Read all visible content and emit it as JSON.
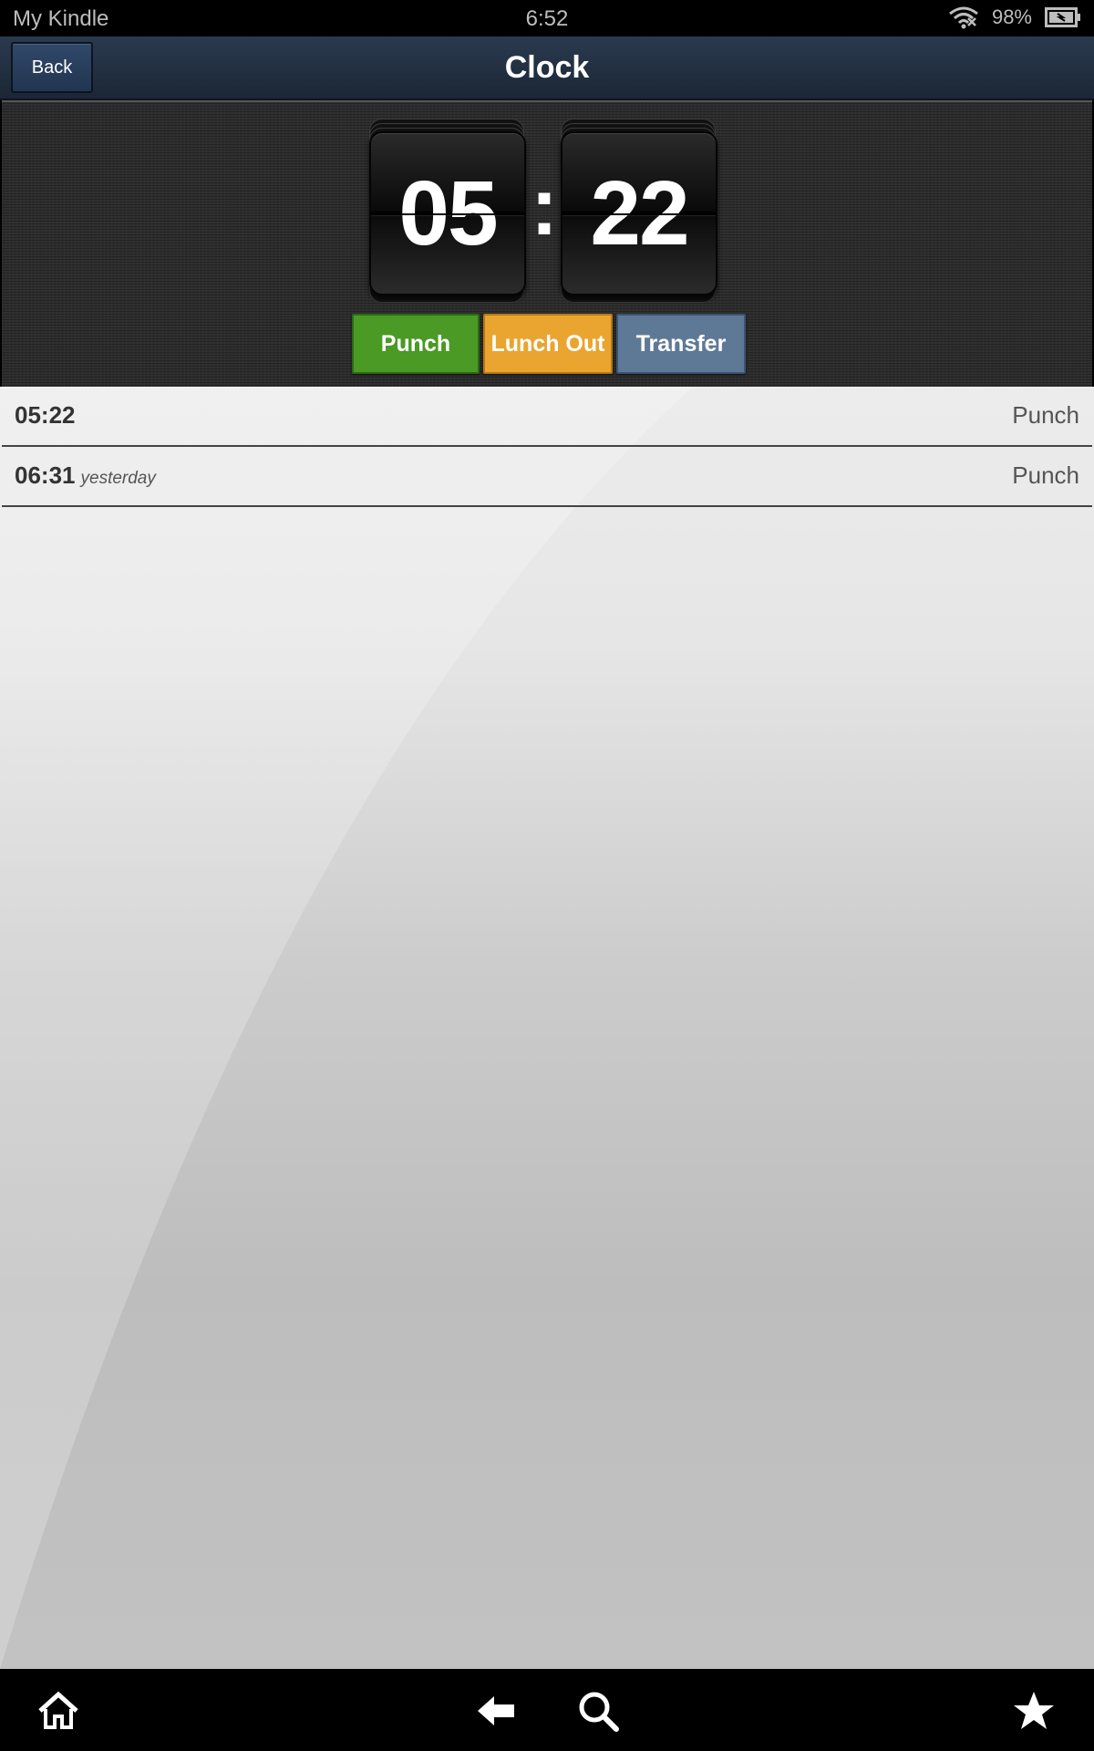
{
  "status_bar": {
    "carrier": "My Kindle",
    "time": "6:52",
    "battery_percent": "98%",
    "icons": [
      "wifi-icon",
      "battery-icon"
    ]
  },
  "header": {
    "back_label": "Back",
    "title": "Clock"
  },
  "clock": {
    "hours": "05",
    "separator": ":",
    "minutes": "22"
  },
  "actions": {
    "punch_label": "Punch",
    "lunch_out_label": "Lunch Out",
    "transfer_label": "Transfer",
    "colors": {
      "punch": "#4a9a25",
      "lunch_out": "#e9a52f",
      "transfer": "#5e7996"
    }
  },
  "history": [
    {
      "time": "05:22",
      "note": "",
      "type": "Punch"
    },
    {
      "time": "06:31",
      "note": "yesterday",
      "type": "Punch"
    }
  ],
  "nav": {
    "icons": [
      "home-icon",
      "back-arrow-icon",
      "search-icon",
      "star-icon"
    ]
  }
}
